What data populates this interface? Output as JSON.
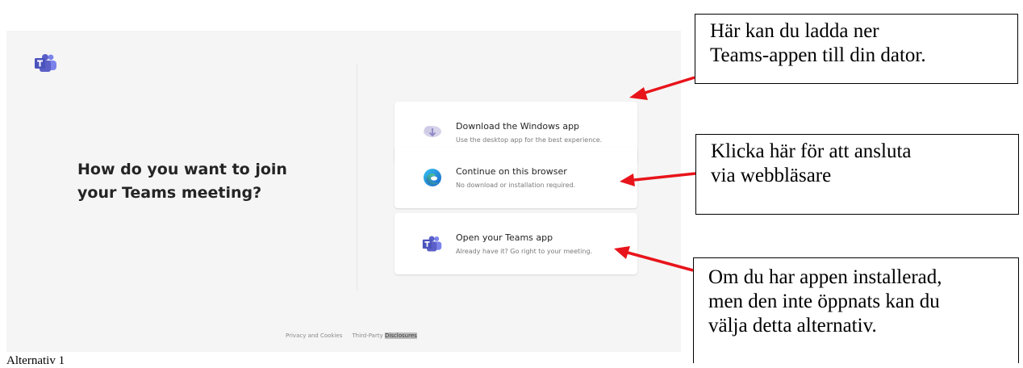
{
  "screen": {
    "heading": {
      "line1": "How do you want to join",
      "line2": "your Teams meeting?"
    },
    "options": [
      {
        "title": "Download the Windows app",
        "subtitle": "Use the desktop app for the best experience.",
        "icon": "download-icon"
      },
      {
        "title": "Continue on this browser",
        "subtitle": "No download or installation required.",
        "icon": "edge-browser-icon"
      },
      {
        "title": "Open your Teams app",
        "subtitle": "Already have it? Go right to your meeting.",
        "icon": "teams-icon"
      }
    ],
    "footer": {
      "privacy": "Privacy and Cookies",
      "third_party": "Third-Party",
      "disclosures": "Disclosures"
    }
  },
  "annotations": [
    {
      "lines": [
        "Här kan du ladda ner",
        "Teams-appen till din dator."
      ]
    },
    {
      "lines": [
        "Klicka här för att ansluta",
        "via webbläsare"
      ]
    },
    {
      "lines": [
        "Om du har appen installerad,",
        "men den inte öppnats kan du",
        "välja detta alternativ."
      ]
    }
  ],
  "caption": "Alternativ 1",
  "colors": {
    "teams_purple": "#5b5fc7",
    "arrow_red": "#e8141b",
    "screen_bg": "#f5f5f5"
  }
}
